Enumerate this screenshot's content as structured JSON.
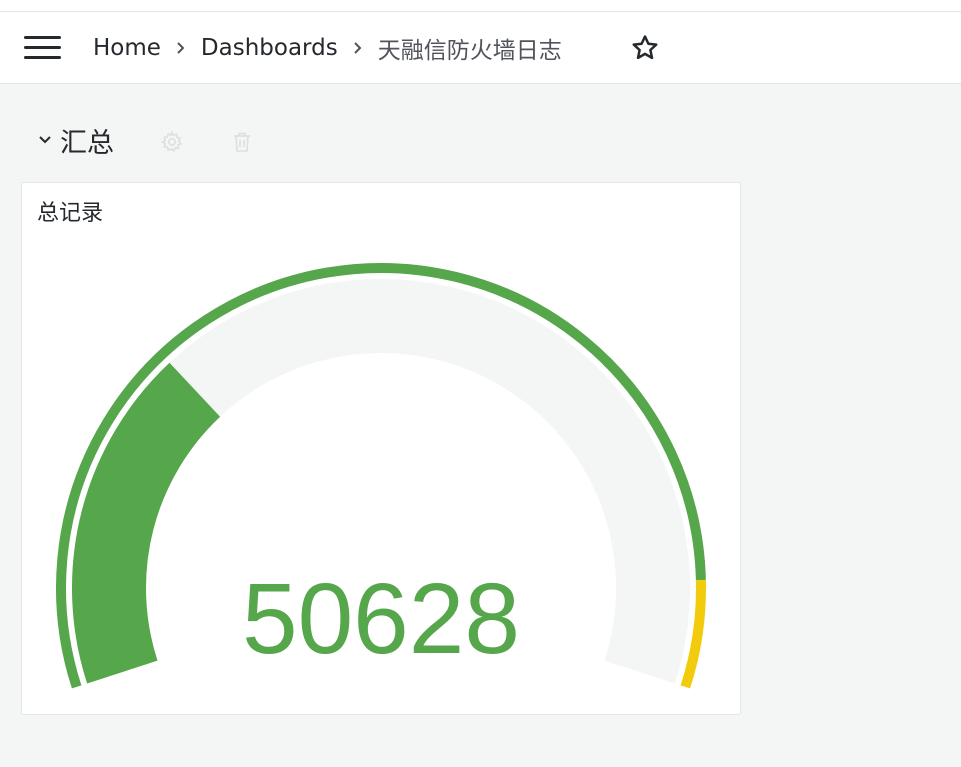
{
  "navbar": {
    "breadcrumbs": [
      "Home",
      "Dashboards",
      "天融信防火墙日志"
    ]
  },
  "row": {
    "title": "汇总"
  },
  "panel": {
    "title": "总记录",
    "gauge": {
      "value": 50628,
      "display_value": "50628",
      "fill_fraction": 0.3,
      "colors": {
        "value": "#56a64b",
        "background": "#f4f5f5",
        "threshold_base": "#56a64b",
        "threshold_warning": "#f2cc0c"
      },
      "threshold_warning_fraction": 0.91
    }
  }
}
